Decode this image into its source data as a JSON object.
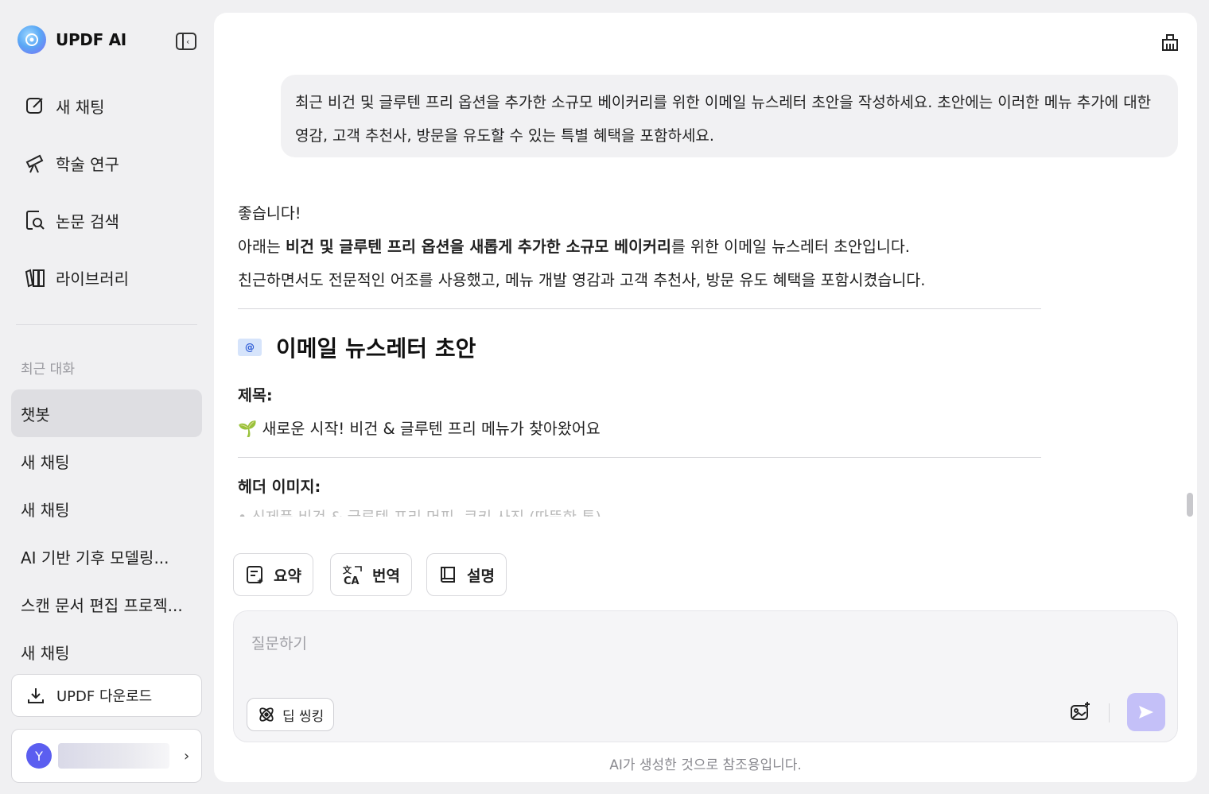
{
  "sidebar": {
    "brand": "UPDF AI",
    "nav": [
      {
        "label": "새 채팅",
        "icon": "edit-icon"
      },
      {
        "label": "학술 연구",
        "icon": "telescope-icon"
      },
      {
        "label": "논문 검색",
        "icon": "doc-search-icon"
      },
      {
        "label": "라이브러리",
        "icon": "library-icon"
      }
    ],
    "recent_title": "최근 대화",
    "recent": [
      "챗봇",
      "새 채팅",
      "새 채팅",
      "AI 기반 기후 모델링...",
      "스캔 문서 편집 프로젝...",
      "새 채팅"
    ],
    "download_label": "UPDF 다운로드",
    "user_initial": "Y"
  },
  "chat": {
    "user_message": "최근 비건 및 글루텐 프리 옵션을 추가한 소규모 베이커리를 위한 이메일 뉴스레터 초안을 작성하세요. 초안에는 이러한 메뉴 추가에 대한 영감, 고객 추천사, 방문을 유도할 수 있는 특별 혜택을 포함하세요.",
    "answer": {
      "greeting": "좋습니다!",
      "intro_prefix": "아래는 ",
      "intro_bold": "비건 및 글루텐 프리 옵션을 새롭게 추가한 소규모 베이커리",
      "intro_suffix": "를 위한 이메일 뉴스레터 초안입니다.",
      "intro_line2": "친근하면서도 전문적인 어조를 사용했고, 메뉴 개발 영감과 고객 추천사, 방문 유도 혜택을 포함시켰습니다.",
      "heading": "이메일 뉴스레터 초안",
      "subject_label": "제목:",
      "subject_emoji": "🌱",
      "subject_text": "새로운 시작! 비건 & 글루텐 프리 메뉴가 찾아왔어요",
      "header_image_label": "헤더 이미지:",
      "header_image_text": "• 신제품 비건 & 글루텐 프리 머핀, 쿠키 사진 (따뜻한 톤)"
    }
  },
  "actions": [
    {
      "label": "요약",
      "icon": "summary-icon"
    },
    {
      "label": "번역",
      "icon": "translate-icon"
    },
    {
      "label": "설명",
      "icon": "book-icon"
    }
  ],
  "input": {
    "placeholder": "질문하기",
    "deep_think_label": "딥 씽킹"
  },
  "disclaimer": "AI가 생성한 것으로 참조용입니다.",
  "colors": {
    "accent": "#5b5ef0",
    "send_button": "#c4c0f8",
    "active_item": "#dedee2"
  }
}
